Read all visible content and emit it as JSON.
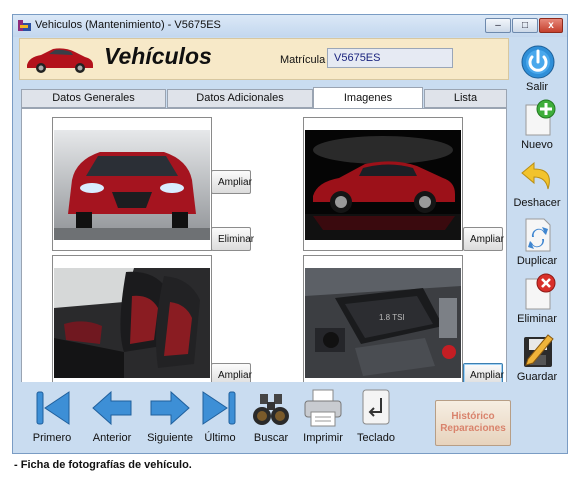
{
  "window": {
    "title": "Vehiculos (Mantenimiento) - V5675ES",
    "minimize_glyph": "–",
    "maximize_glyph": "□",
    "close_glyph": "x"
  },
  "header": {
    "title": "Vehículos",
    "matricula_label": "Matrícula",
    "matricula_value": "V5675ES",
    "logo_icon": "red-car-icon"
  },
  "tabs": [
    {
      "label": "Datos Generales",
      "active": false
    },
    {
      "label": "Datos Adicionales",
      "active": false
    },
    {
      "label": "Imagenes",
      "active": true
    },
    {
      "label": "Lista",
      "active": false
    }
  ],
  "photos": [
    {
      "subject": "car-front-photo",
      "buttons": [
        "Ampliar",
        "Eliminar"
      ]
    },
    {
      "subject": "car-side-photo",
      "buttons": [
        "Ampliar"
      ]
    },
    {
      "subject": "car-interior-photo",
      "buttons": [
        "Ampliar"
      ]
    },
    {
      "subject": "car-engine-photo",
      "buttons": [
        "Ampliar"
      ]
    }
  ],
  "side_actions": [
    {
      "label": "Salir",
      "icon": "power-icon"
    },
    {
      "label": "Nuevo",
      "icon": "new-document-icon"
    },
    {
      "label": "Deshacer",
      "icon": "undo-arrow-icon"
    },
    {
      "label": "Duplicar",
      "icon": "duplicate-document-icon"
    },
    {
      "label": "Eliminar",
      "icon": "delete-document-icon"
    },
    {
      "label": "Guardar",
      "icon": "save-disk-icon"
    }
  ],
  "bottom_actions": [
    {
      "label": "Primero",
      "icon": "first-record-icon"
    },
    {
      "label": "Anterior",
      "icon": "previous-arrow-icon"
    },
    {
      "label": "Siguiente",
      "icon": "next-arrow-icon"
    },
    {
      "label": "Último",
      "icon": "last-record-icon"
    },
    {
      "label": "Buscar",
      "icon": "binoculars-icon"
    },
    {
      "label": "Imprimir",
      "icon": "printer-icon"
    },
    {
      "label": "Teclado",
      "icon": "enter-key-icon"
    }
  ],
  "historico_button": {
    "line1": "Histórico",
    "line2": "Reparaciones"
  },
  "caption": "- Ficha de fotografías de vehículo.",
  "colors": {
    "window_bg": "#c9dcf0",
    "header_bg": "#f7e9c8",
    "car_red": "#b3121c",
    "historico_text": "#d9836c"
  }
}
